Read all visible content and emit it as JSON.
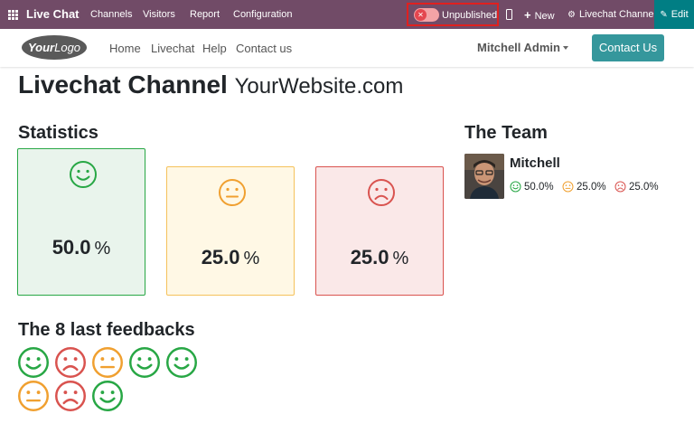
{
  "topbar": {
    "app_title": "Live Chat",
    "menu": [
      "Channels",
      "Visitors",
      "Report",
      "Configuration"
    ],
    "publish_label": "Unpublished",
    "new_label": "New",
    "channel_label": "Livechat Channel",
    "edit_label": "Edit"
  },
  "header": {
    "logo_first": "Your",
    "logo_second": "Logo",
    "nav": [
      "Home",
      "Livechat",
      "Help",
      "Contact us"
    ],
    "user": "Mitchell Admin",
    "contact_button": "Contact Us"
  },
  "page": {
    "title": "Livechat Channel",
    "subtitle": "YourWebsite.com",
    "statistics_heading": "Statistics",
    "team_heading": "The Team",
    "feedbacks_heading": "The 8 last feedbacks"
  },
  "statistics": {
    "happy": {
      "value": "50.0",
      "unit": "%"
    },
    "neutral": {
      "value": "25.0",
      "unit": "%"
    },
    "unhappy": {
      "value": "25.0",
      "unit": "%"
    }
  },
  "team": {
    "member_name": "Mitchell",
    "happy": "50.0%",
    "neutral": "25.0%",
    "unhappy": "25.0%"
  },
  "feedbacks": [
    "happy",
    "unhappy",
    "neutral",
    "happy",
    "happy",
    "neutral",
    "unhappy",
    "happy"
  ],
  "colors": {
    "happy": "#28a745",
    "neutral": "#f0a030",
    "unhappy": "#d9534f",
    "topbar": "#714b67",
    "accent": "#35979c",
    "edit": "#017e84"
  }
}
